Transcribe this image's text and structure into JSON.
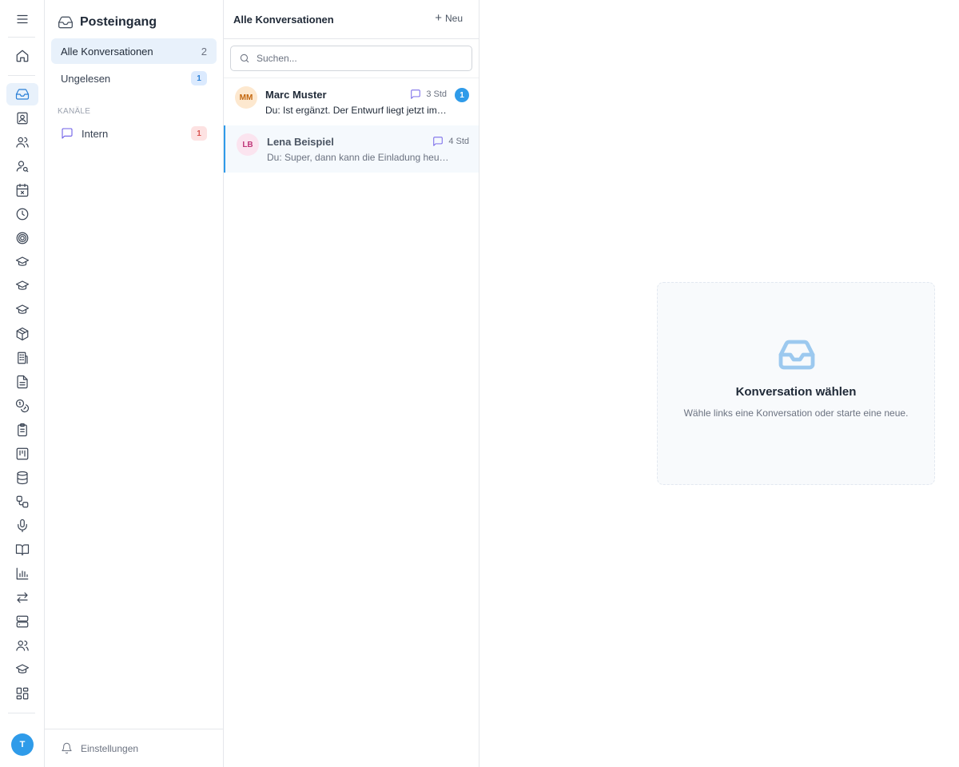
{
  "rail": {
    "avatar_initial": "T",
    "icons": [
      "menu-icon",
      "home-icon",
      "inbox-icon",
      "contact-card-icon",
      "users-icon",
      "user-search-icon",
      "calendar-x-icon",
      "clock-icon",
      "target-icon",
      "graduation-cap-icon",
      "graduation-cap-icon",
      "graduation-cap-icon",
      "package-icon",
      "building-icon",
      "document-icon",
      "coins-icon",
      "clipboard-icon",
      "kanban-icon",
      "database-icon",
      "workflow-icon",
      "microphone-icon",
      "book-open-icon",
      "bar-chart-icon",
      "arrows-left-right-icon",
      "server-icon",
      "users-icon",
      "graduation-cap-icon",
      "grid-icon"
    ]
  },
  "sidebar": {
    "title": "Posteingang",
    "items": [
      {
        "label": "Alle Konversationen",
        "count": "2"
      },
      {
        "label": "Ungelesen",
        "badge": "1"
      }
    ],
    "section_label": "KANÄLE",
    "channels": [
      {
        "label": "Intern",
        "badge": "1"
      }
    ],
    "footer_label": "Einstellungen"
  },
  "conversations": {
    "title": "Alle Konversationen",
    "new_label": "Neu",
    "search_placeholder": "Suchen...",
    "items": [
      {
        "initials": "MM",
        "name": "Marc Muster",
        "time": "3 Std",
        "preview": "Du: Ist ergänzt. Der Entwurf liegt jetzt im Ordner bereit.",
        "unread": "1",
        "avatar_bg": "#fde8cf",
        "avatar_fg": "#c2660e"
      },
      {
        "initials": "LB",
        "name": "Lena Beispiel",
        "time": "4 Std",
        "preview": "Du: Super, dann kann die Einladung heute noch raus.",
        "avatar_bg": "#fbe4ef",
        "avatar_fg": "#c0397a"
      }
    ]
  },
  "empty_state": {
    "title": "Konversation wählen",
    "subtitle": "Wähle links eine Konversation oder starte eine neue."
  },
  "colors": {
    "accent": "#2f9be9",
    "active_bg": "#e8f1fb",
    "channel_icon": "#6c5ce7"
  }
}
